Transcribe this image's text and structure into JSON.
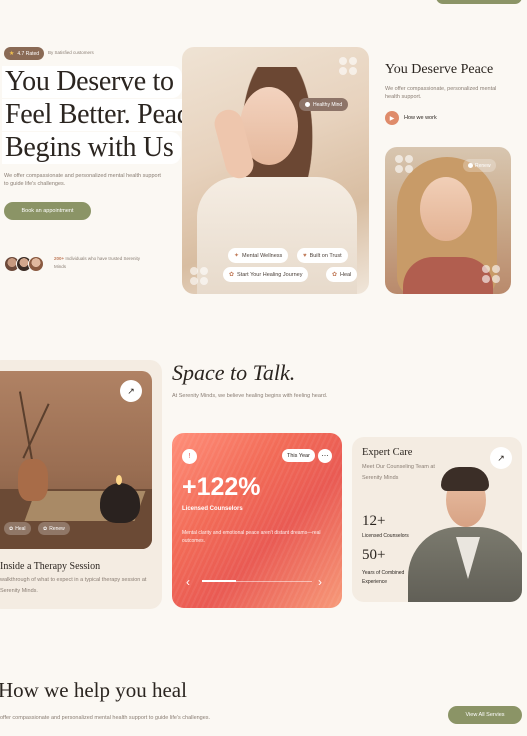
{
  "hero": {
    "rating_label": "4.7 Rated",
    "rating_sub": "By Satisfied customers",
    "title_lines": [
      "You Deserve to",
      "Feel Better. Peace",
      "Begins with Us"
    ],
    "description": "We offer compassionate and personalized mental health support to guide life's challenges.",
    "appointment_button": "Book an appointment",
    "trust_count": "200+",
    "trust_text": "Individuals who have trusted Serenity Minds"
  },
  "hero_image": {
    "badge": "Healthy Mind",
    "chips": [
      "Mental Wellness",
      "Built on Trust",
      "Start Your Healing Journey",
      "Heal"
    ]
  },
  "aside": {
    "title": "You Deserve Peace",
    "description": "We offer compassionate, personalized mental health support.",
    "how_we_work": "How we work",
    "girl_badge": "Renew"
  },
  "therapy": {
    "tags": [
      "Heal",
      "Renew"
    ],
    "title": "Inside a Therapy Session",
    "description": "walkthrough of what to expect in a typical therapy session at Serenity Minds."
  },
  "talk": {
    "title": "Space to Talk.",
    "description": "At Serenity Minds, we believe healing begins with feeling heard."
  },
  "stats": {
    "period": "This Year",
    "value": "+122%",
    "label": "Licensed Counselors",
    "description": "Mental clarity and emotional peace aren't distant dreams—real outcomes."
  },
  "expert": {
    "title": "Expert Care",
    "description": "Meet Our Counseling Team at Serenity Minds",
    "stat1_value": "12+",
    "stat1_label": "Licensed Counselors",
    "stat2_value": "50+",
    "stat2_label": "Years of Combined Experience"
  },
  "heal": {
    "title": "How we help you heal",
    "description": "offer compassionate and personalized mental health support to guide life's challenges.",
    "view_all": "View All Servies"
  },
  "colors": {
    "accent_green": "#8b9466",
    "accent_coral": "#e95a53",
    "background": "#fbf8f3"
  }
}
